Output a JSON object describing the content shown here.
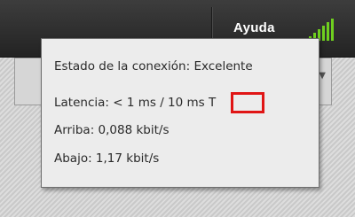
{
  "topbar": {
    "help_label": "Ayuda",
    "signal_icon": "signal-strength-icon",
    "signal_color": "#6fcf1f"
  },
  "tooltip": {
    "status_label": "Estado de la conexión:",
    "status_value": "Excelente",
    "latency_text": "Latencia:  < 1 ms / 10 ms T",
    "upload_text": "Arriba:  0,088 kbit/s",
    "download_text": "Abajo:  1,17 kbit/s"
  },
  "colors": {
    "highlight": "#e01515",
    "tooltip_bg": "#ececec",
    "topbar_bg": "#2e2e2e"
  }
}
